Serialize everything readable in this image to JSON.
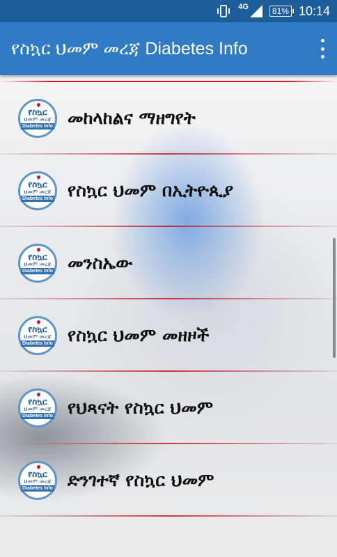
{
  "status_bar": {
    "network": "4G",
    "battery": "81%",
    "time": "10:14"
  },
  "app_bar": {
    "title": "የስኳር ህመም መረጃ Diabetes Info",
    "menu_icon": "more-vert-icon"
  },
  "list": {
    "logo": {
      "line1": "የስኳር",
      "line2": "ህመም መረጃ",
      "line3": "Diabetes Info"
    },
    "items": [
      {
        "label": "መከላከልና ማዘግየት"
      },
      {
        "label": "የስኳር ህመም በኢትዮጲያ"
      },
      {
        "label": "መንስኤው"
      },
      {
        "label": "የስኳር ህመም መዘዞች"
      },
      {
        "label": "የህጻናት የስኳር ህመም"
      },
      {
        "label": "ድንገተኛ የስኳር ህመም"
      }
    ]
  },
  "colors": {
    "status_bar": "#1b5e9a",
    "app_bar": "#2f7bc4",
    "divider": "#d0102c"
  }
}
